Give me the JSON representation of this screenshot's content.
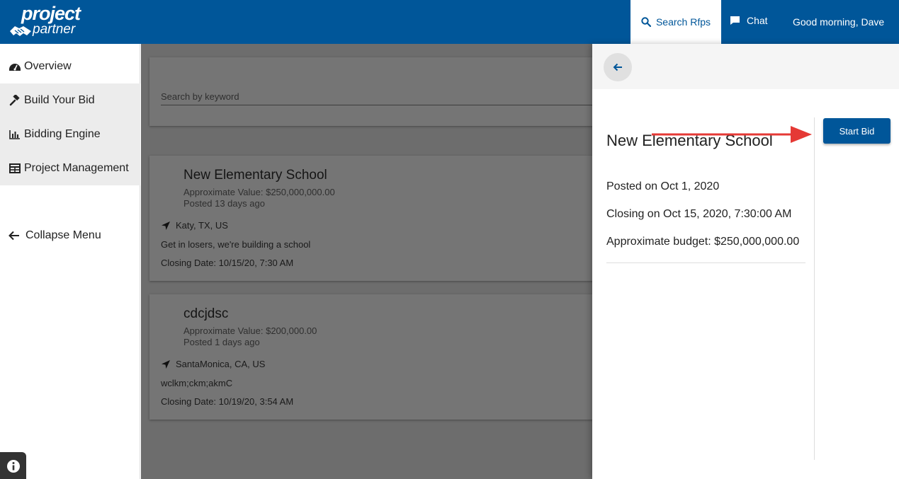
{
  "brand": {
    "line1": "project",
    "line2": "partner"
  },
  "header": {
    "search_label": "Search Rfps",
    "chat_label": "Chat",
    "greeting": "Good morning, Dave"
  },
  "sidebar": {
    "items": [
      {
        "label": "Overview",
        "icon": "dashboard-icon"
      },
      {
        "label": "Build Your Bid",
        "icon": "gavel-icon"
      },
      {
        "label": "Bidding Engine",
        "icon": "bar-chart-icon"
      },
      {
        "label": "Project Management",
        "icon": "table-icon"
      }
    ],
    "collapse_label": "Collapse Menu"
  },
  "search": {
    "placeholder": "Search by keyword"
  },
  "rfps": [
    {
      "title": "New Elementary School",
      "value": "Approximate Value: $250,000,000.00",
      "posted": "Posted 13 days ago",
      "location": "Katy, TX, US",
      "description": "Get in losers, we're building a school",
      "closing": "Closing Date: 10/15/20, 7:30 AM"
    },
    {
      "title": "cdcjdsc",
      "value": "Approximate Value: $200,000.00",
      "posted": "Posted 1 days ago",
      "location": "SantaMonica, CA, US",
      "description": "wclkm;ckm;akmC",
      "closing": "Closing Date: 10/19/20, 3:54 AM"
    }
  ],
  "detail": {
    "title": "New Elementary School",
    "posted": "Posted on Oct 1, 2020",
    "closing": "Closing on Oct 15, 2020, 7:30:00 AM",
    "budget": "Approximate budget: $250,000,000.00",
    "start_bid_label": "Start Bid"
  },
  "colors": {
    "brand_blue": "#005699",
    "annotation_red": "#e53935"
  }
}
